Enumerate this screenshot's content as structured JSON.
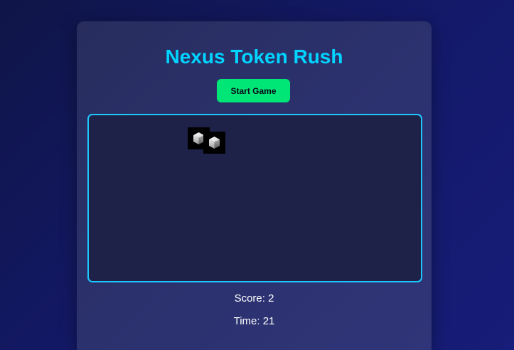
{
  "game": {
    "title": "Nexus Token Rush",
    "start_button_label": "Start Game",
    "score_text": "Score: 2",
    "time_text": "Time: 21",
    "score": 2,
    "time_remaining": 21,
    "tokens": [
      {
        "name": "token-cube-icon"
      },
      {
        "name": "token-cube-icon"
      }
    ]
  },
  "colors": {
    "title": "#00d4ff",
    "start_button": "#00e676",
    "game_area_border": "#1ec8ff",
    "game_area_bg": "#1e2248",
    "card_bg": "#2c3270",
    "page_bg": "#14196a"
  }
}
